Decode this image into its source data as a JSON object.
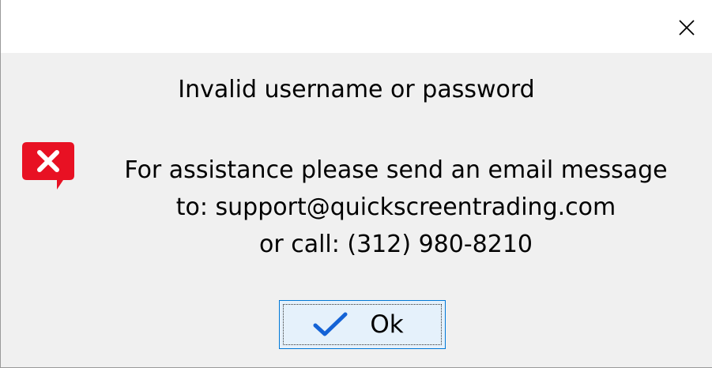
{
  "window": {
    "close_icon": "close-icon"
  },
  "dialog": {
    "heading": "Invalid username or password",
    "icon": "error-icon",
    "message_lines": [
      "For assistance please send an email message",
      "to: support@quickscreentrading.com",
      "or call: (312) 980-8210"
    ]
  },
  "buttons": {
    "ok_label": "Ok",
    "ok_icon": "checkmark-icon"
  },
  "colors": {
    "error_red": "#e81123",
    "check_blue": "#1463d6",
    "button_bg": "#e5f1fb",
    "button_border": "#0078d7"
  }
}
